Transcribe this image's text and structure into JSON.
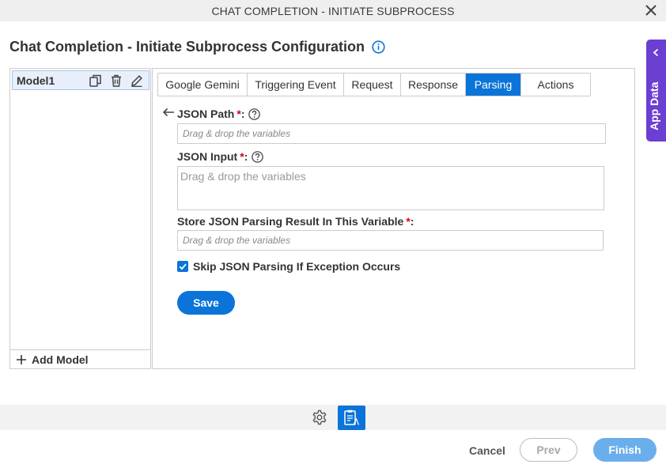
{
  "window": {
    "title": "CHAT COMPLETION - INITIATE SUBPROCESS"
  },
  "page": {
    "heading": "Chat Completion - Initiate Subprocess Configuration"
  },
  "side_tab": {
    "label": "App Data"
  },
  "models": {
    "items": [
      {
        "label": "Model1"
      }
    ],
    "add_label": "Add Model"
  },
  "tabs": [
    {
      "label": "Google Gemini"
    },
    {
      "label": "Triggering Event"
    },
    {
      "label": "Request"
    },
    {
      "label": "Response"
    },
    {
      "label": "Parsing",
      "active": true
    },
    {
      "label": "Actions"
    }
  ],
  "form": {
    "json_path": {
      "label": "JSON Path",
      "required": "*",
      "colon": ":",
      "placeholder": "Drag & drop the variables"
    },
    "json_input": {
      "label": "JSON Input",
      "required": "*",
      "colon": ":",
      "placeholder": "Drag & drop the variables"
    },
    "store_result": {
      "label": "Store JSON Parsing Result In This Variable",
      "required": "*",
      "colon": ":",
      "placeholder": "Drag & drop the variables"
    },
    "skip_exception": {
      "label": "Skip JSON Parsing If Exception Occurs",
      "checked": true
    },
    "save_label": "Save"
  },
  "footer": {
    "cancel_label": "Cancel",
    "prev_label": "Prev",
    "finish_label": "Finish"
  },
  "colors": {
    "accent": "#0b74d9",
    "side_tab": "#6b3fd1",
    "required": "#d0021b",
    "finish_disabled": "#6aaeec"
  }
}
